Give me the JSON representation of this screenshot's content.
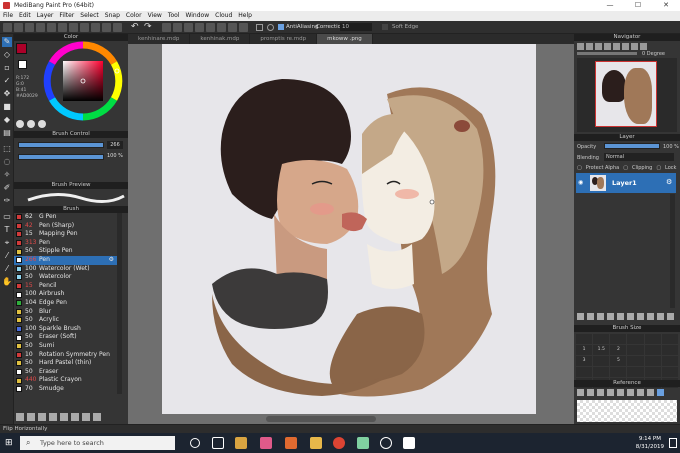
{
  "window": {
    "title": "MediBang Paint Pro (64bit)",
    "controls": [
      "—",
      "☐",
      "✕"
    ]
  },
  "menu": [
    "File",
    "Edit",
    "Layer",
    "Filter",
    "Select",
    "Snap",
    "Color",
    "View",
    "Tool",
    "Window",
    "Cloud",
    "Help"
  ],
  "toolbar": {
    "antialias_label": "AntiAliasing",
    "correction_label": "Correction",
    "correction_value": "10",
    "soft_edge": "Soft Edge"
  },
  "tabs": [
    "kenhinare.mdp",
    "kenhinak.mdp",
    "promptis re.mdp",
    "mkoww .png"
  ],
  "tabs_active": 3,
  "color_panel": {
    "title": "Color",
    "r": "R:172",
    "g": "G:0",
    "b": "B:41",
    "hex": "#AD0029",
    "primary": "#ac0029",
    "secondary": "#ffffff"
  },
  "brush_control": {
    "title": "Brush Control",
    "size": "266",
    "opacity": "100 %"
  },
  "brush_preview": {
    "title": "Brush Preview"
  },
  "brush_list": {
    "title": "Brush",
    "items": [
      {
        "size": "62",
        "name": "G Pen",
        "color": "#d23a3a",
        "red": false
      },
      {
        "size": "42",
        "name": "Pen (Sharp)",
        "color": "#d23a3a",
        "red": true
      },
      {
        "size": "15",
        "name": "Mapping Pen",
        "color": "#d23a3a",
        "red": false
      },
      {
        "size": "313",
        "name": "Pen",
        "color": "#d23a3a",
        "red": true
      },
      {
        "size": "50",
        "name": "Stipple Pen",
        "color": "#e0c040",
        "red": false
      },
      {
        "size": "266",
        "name": "Pen",
        "color": "#ffffff",
        "red": true,
        "selected": true
      },
      {
        "size": "100",
        "name": "Watercolor (Wet)",
        "color": "#8fd6f0",
        "red": false
      },
      {
        "size": "50",
        "name": "Watercolor",
        "color": "#8fd6f0",
        "red": false
      },
      {
        "size": "15",
        "name": "Pencil",
        "color": "#d23a3a",
        "red": true
      },
      {
        "size": "100",
        "name": "Airbrush",
        "color": "#ffffff",
        "red": false
      },
      {
        "size": "104",
        "name": "Edge Pen",
        "color": "#2fae3c",
        "red": false
      },
      {
        "size": "50",
        "name": "Blur",
        "color": "#e0c040",
        "red": false
      },
      {
        "size": "50",
        "name": "Acrylic",
        "color": "#e0c040",
        "red": false
      },
      {
        "size": "100",
        "name": "Sparkle Brush",
        "color": "#4a6ee0",
        "red": false
      },
      {
        "size": "50",
        "name": "Eraser (Soft)",
        "color": "#ffffff",
        "red": false
      },
      {
        "size": "50",
        "name": "Sumi",
        "color": "#e0c040",
        "red": false
      },
      {
        "size": "10",
        "name": "Rotation Symmetry Pen",
        "color": "#d23a3a",
        "red": false
      },
      {
        "size": "50",
        "name": "Hard Pastel (thin)",
        "color": "#e0c040",
        "red": false
      },
      {
        "size": "50",
        "name": "Eraser",
        "color": "#ffffff",
        "red": false
      },
      {
        "size": "440",
        "name": "Plastic Crayon",
        "color": "#e0c040",
        "red": true
      },
      {
        "size": "70",
        "name": "Smudge",
        "color": "#ffffff",
        "red": false
      }
    ]
  },
  "navigator": {
    "title": "Navigator",
    "rotation": "0 Degree"
  },
  "layer_panel": {
    "title": "Layer",
    "opacity_label": "Opacity",
    "opacity_value": "100 %",
    "blending_label": "Blending",
    "blending_value": "Normal",
    "protect_alpha": "Protect Alpha",
    "clipping": "Clipping",
    "lock": "Lock",
    "layer_name": "Layer1"
  },
  "brush_size": {
    "title": "Brush Size",
    "values": [
      "",
      "",
      "",
      "",
      "",
      "",
      "1",
      "1.5",
      "2",
      "",
      "",
      "",
      "3",
      "",
      "5",
      "",
      "",
      "",
      "",
      "",
      "",
      "",
      "",
      "",
      "",
      "",
      "",
      "",
      "",
      ""
    ]
  },
  "reference": {
    "title": "Reference"
  },
  "status": "Flip Horizontally",
  "taskbar": {
    "search_placeholder": "Type here to search",
    "time": "9:14 PM",
    "date": "8/31/2019"
  }
}
